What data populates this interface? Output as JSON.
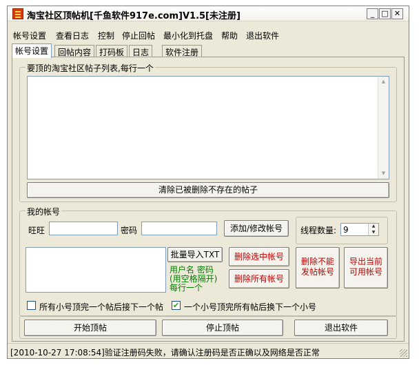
{
  "window": {
    "title": "淘宝社区顶帖机[千鱼软件917e.com]V1.5[未注册]",
    "buttons": {
      "minimize": "_",
      "maximize": "□",
      "close": "✕"
    }
  },
  "menu": [
    "帐号设置",
    "查看日志",
    "控制",
    "停止回帖",
    "最小化到托盘",
    "帮助",
    "退出软件"
  ],
  "tabs": [
    "帐号设置",
    "回帖内容",
    "打码板",
    "日志",
    "软件注册"
  ],
  "posts_group": {
    "label": "要顶的淘宝社区帖子列表,每行一个",
    "clear_button": "清除已被删除不存在的帖子"
  },
  "accounts_group": {
    "label": "我的帐号",
    "wangwang_label": "旺旺",
    "password_label": "密码",
    "wangwang_value": "",
    "password_value": "",
    "add_button": "添加/修改帐号",
    "thread_label": "线程数量:",
    "thread_value": "9",
    "import_button": "批量导入TXT",
    "import_hint": [
      "用户名 密码",
      "(用空格隔开)",
      "每行一个"
    ],
    "delete_selected_button": "删除选中帐号",
    "delete_all_button": "删除所有帐号",
    "delete_unable_button": [
      "删除不能",
      "发帖帐号"
    ],
    "export_button": [
      "导出当前",
      "可用帐号"
    ]
  },
  "options": [
    {
      "label": "所有小号顶完一个帖后接下一个帖",
      "checked": false
    },
    {
      "label": "一个小号顶完所有帖后换下一个小号",
      "checked": true
    }
  ],
  "actions": {
    "start": "开始顶帖",
    "stop": "停止顶帖",
    "exit": "退出软件"
  },
  "status": "[2010-10-27 17:08:54]验证注册码失败，请确认注册码是否正确以及网络是否正常",
  "colors": {
    "red_button_text": "#c00000",
    "hint_text": "#008000",
    "window_bg": "#ece9d8"
  }
}
